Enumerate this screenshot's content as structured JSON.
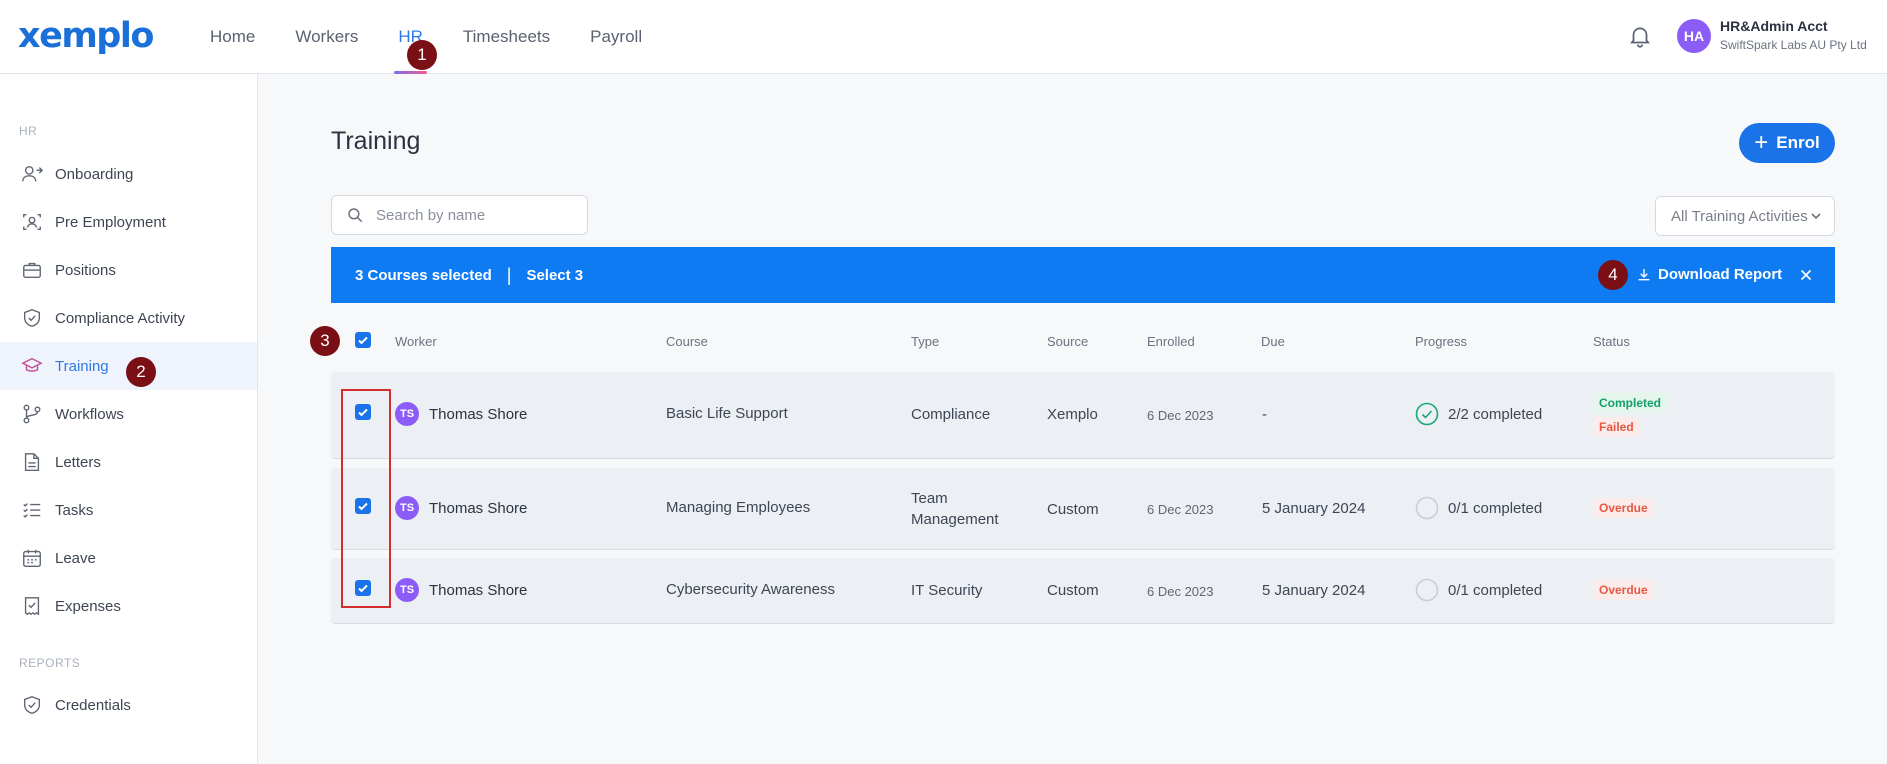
{
  "header": {
    "logo": "xemplo",
    "nav": [
      "Home",
      "Workers",
      "HR",
      "Timesheets",
      "Payroll"
    ],
    "active_nav": "HR",
    "account": {
      "initials": "HA",
      "name": "HR&Admin Acct",
      "org": "SwiftSpark Labs AU Pty Ltd"
    }
  },
  "sidebar": {
    "hr_label": "HR",
    "reports_label": "REPORTS",
    "items": [
      {
        "label": "Onboarding",
        "icon": "user-arrow-icon"
      },
      {
        "label": "Pre Employment",
        "icon": "user-scan-icon"
      },
      {
        "label": "Positions",
        "icon": "briefcase-icon"
      },
      {
        "label": "Compliance Activity",
        "icon": "shield-check-icon"
      },
      {
        "label": "Training",
        "icon": "graduation-cap-icon"
      },
      {
        "label": "Workflows",
        "icon": "workflow-icon"
      },
      {
        "label": "Letters",
        "icon": "document-icon"
      },
      {
        "label": "Tasks",
        "icon": "checklist-icon"
      },
      {
        "label": "Leave",
        "icon": "calendar-icon"
      },
      {
        "label": "Expenses",
        "icon": "receipt-icon"
      }
    ],
    "report_items": [
      {
        "label": "Credentials",
        "icon": "shield-check-icon"
      }
    ],
    "active": "Training"
  },
  "main": {
    "title": "Training",
    "enrol_label": "Enrol",
    "search_placeholder": "Search by name",
    "filter_value": "All Training Activities",
    "selection": {
      "count_text": "3 Courses selected",
      "select_text": "Select 3",
      "download_label": "Download Report"
    },
    "columns": [
      "Worker",
      "Course",
      "Type",
      "Source",
      "Enrolled",
      "Due",
      "Progress",
      "Status"
    ],
    "rows": [
      {
        "initials": "TS",
        "worker": "Thomas Shore",
        "course": "Basic Life Support",
        "type": "Compliance",
        "source": "Xemplo",
        "enrolled": "6 Dec 2023",
        "due": "-",
        "progress": "2/2 completed",
        "progress_state": "complete",
        "statuses": [
          "Completed",
          "Failed"
        ],
        "checked": true
      },
      {
        "initials": "TS",
        "worker": "Thomas Shore",
        "course": "Managing Employees",
        "type": "Team Management",
        "source": "Custom",
        "enrolled": "6 Dec 2023",
        "due": "5 January 2024",
        "progress": "0/1 completed",
        "progress_state": "empty",
        "statuses": [
          "Overdue"
        ],
        "checked": true
      },
      {
        "initials": "TS",
        "worker": "Thomas Shore",
        "course": "Cybersecurity Awareness",
        "type": "IT Security",
        "source": "Custom",
        "enrolled": "6 Dec 2023",
        "due": "5 January 2024",
        "progress": "0/1 completed",
        "progress_state": "empty",
        "statuses": [
          "Overdue"
        ],
        "checked": true
      }
    ]
  },
  "annotations": [
    "1",
    "2",
    "3",
    "4"
  ],
  "colors": {
    "accent": "#1a73e8",
    "selection_bar": "#0f7bf2",
    "marker": "#7a0f16",
    "highlight_box": "#d42d2d"
  }
}
